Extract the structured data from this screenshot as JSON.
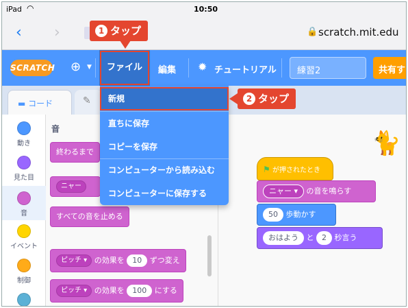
{
  "status_bar": {
    "device": "iPad",
    "time": "10:50"
  },
  "browser": {
    "url": "scratch.mit.edu"
  },
  "menubar": {
    "logo": "SCRATCH",
    "file": "ファイル",
    "edit": "編集",
    "tutorials": "チュートリアル",
    "project_title": "練習2",
    "share": "共有す"
  },
  "tabs": {
    "code": "コード"
  },
  "file_menu": {
    "items": [
      "新規",
      "直ちに保存",
      "コピーを保存",
      "コンピューターから読み込む",
      "コンピューターに保存する"
    ]
  },
  "categories": [
    {
      "label": "動き",
      "color": "#4c97ff"
    },
    {
      "label": "見た目",
      "color": "#9966ff"
    },
    {
      "label": "音",
      "color": "#cf63cf"
    },
    {
      "label": "イベント",
      "color": "#ffd500"
    },
    {
      "label": "制御",
      "color": "#ffab19"
    },
    {
      "label": "",
      "color": "#5cb1d6"
    }
  ],
  "palette": {
    "title": "音",
    "block_play_until_done": "終わるまで",
    "block_sound_menu": "ニャー",
    "block_stop_all": "すべての音を止める",
    "block_change_effect": {
      "menu": "ピッチ ▾",
      "text1": "の効果を",
      "value": "10",
      "text2": "ずつ変え"
    },
    "block_set_effect": {
      "menu": "ピッチ ▾",
      "text1": "の効果を",
      "value": "100",
      "text2": "にする"
    }
  },
  "script": {
    "hat": "が押されたとき",
    "sound_menu": "ニャー ▾",
    "sound_text": "の音を鳴らす",
    "move_value": "50",
    "move_text": "歩動かす",
    "say_value": "おはよう",
    "say_mid": "と",
    "say_secs": "2",
    "say_text": "秒言う"
  },
  "callouts": {
    "step1": {
      "num": "1",
      "label": "タップ"
    },
    "step2": {
      "num": "2",
      "label": "タップ"
    }
  },
  "colors": {
    "scratch_blue": "#4c97ff",
    "callout_red": "#e4462f",
    "sound": "#cf63cf"
  }
}
